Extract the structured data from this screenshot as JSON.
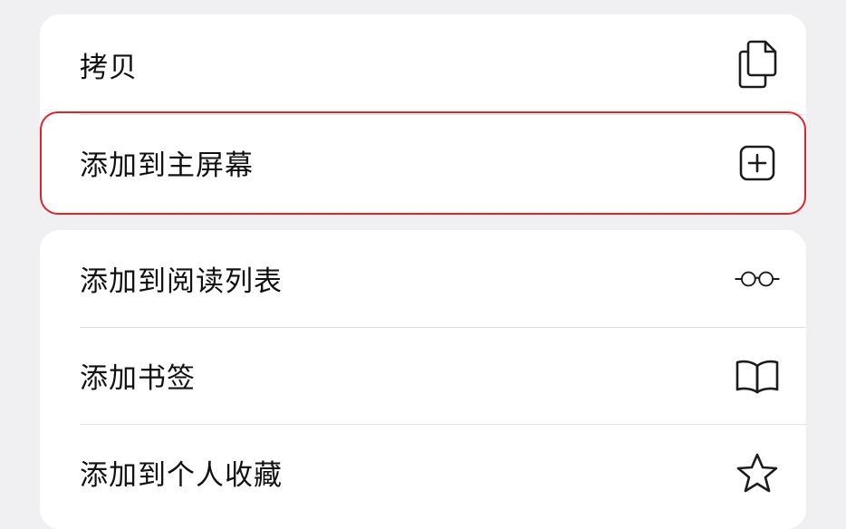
{
  "share_menu": {
    "group_top": [
      {
        "label": "拷贝",
        "icon": "copy-icon"
      },
      {
        "label": "添加到主屏幕",
        "icon": "add-square-icon"
      }
    ],
    "group_bottom": [
      {
        "label": "添加到阅读列表",
        "icon": "glasses-icon"
      },
      {
        "label": "添加书签",
        "icon": "book-icon"
      },
      {
        "label": "添加到个人收藏",
        "icon": "star-icon"
      }
    ]
  },
  "colors": {
    "highlight": "#e0242c",
    "background": "#f0f0f2",
    "card": "#ffffff",
    "icon": "#1c1c1e"
  }
}
